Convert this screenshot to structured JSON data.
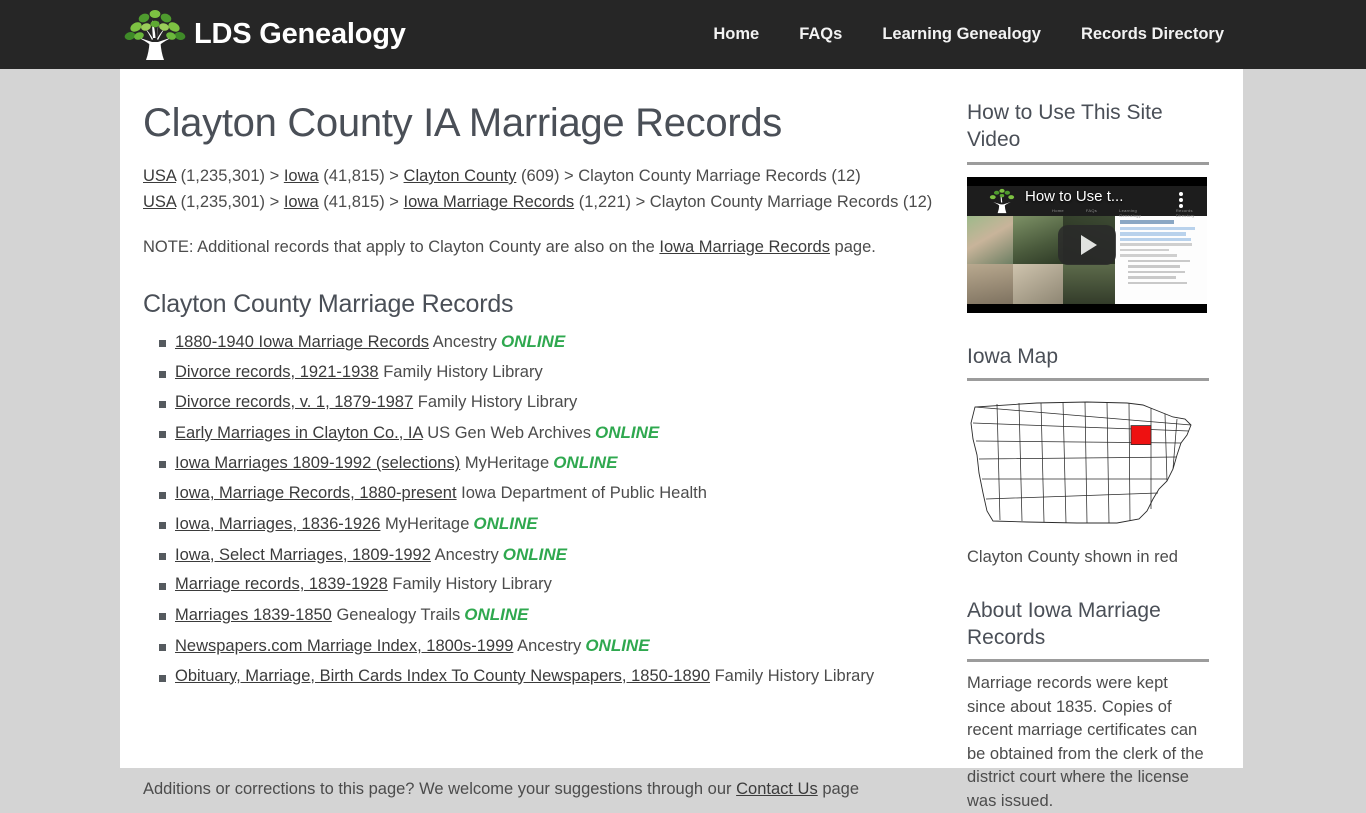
{
  "header": {
    "brand_name": "LDS Genealogy",
    "logo_icon": "family-tree-logo-icon",
    "nav": [
      {
        "label": "Home"
      },
      {
        "label": "FAQs"
      },
      {
        "label": "Learning Genealogy"
      },
      {
        "label": "Records Directory"
      }
    ]
  },
  "main": {
    "page_title": "Clayton County IA Marriage Records",
    "breadcrumb_rows": [
      {
        "parts": [
          {
            "text": "USA",
            "link": true
          },
          {
            "text": " (1,235,301) > ",
            "link": false
          },
          {
            "text": "Iowa",
            "link": true
          },
          {
            "text": " (41,815) > ",
            "link": false
          },
          {
            "text": "Clayton County",
            "link": true
          },
          {
            "text": " (609) > Clayton County Marriage Records (12)",
            "link": false
          }
        ]
      },
      {
        "parts": [
          {
            "text": "USA",
            "link": true
          },
          {
            "text": " (1,235,301) > ",
            "link": false
          },
          {
            "text": "Iowa",
            "link": true
          },
          {
            "text": " (41,815) > ",
            "link": false
          },
          {
            "text": "Iowa Marriage Records",
            "link": true
          },
          {
            "text": " (1,221) > Clayton County Marriage Records (12)",
            "link": false
          }
        ]
      }
    ],
    "note_prefix": "NOTE: Additional records that apply to Clayton County are also on the ",
    "note_link": "Iowa Marriage Records",
    "note_suffix": " page.",
    "section_heading": "Clayton County Marriage Records",
    "records": [
      {
        "title": "1880-1940 Iowa Marriage Records",
        "source": "Ancestry",
        "online": "ONLINE"
      },
      {
        "title": "Divorce records, 1921-1938",
        "source": "Family History Library",
        "online": ""
      },
      {
        "title": "Divorce records, v. 1, 1879-1987",
        "source": "Family History Library",
        "online": ""
      },
      {
        "title": "Early Marriages in Clayton Co., IA",
        "source": "US Gen Web Archives",
        "online": "ONLINE"
      },
      {
        "title": "Iowa Marriages 1809-1992 (selections)",
        "source": "MyHeritage",
        "online": "ONLINE"
      },
      {
        "title": "Iowa, Marriage Records, 1880-present",
        "source": "Iowa Department of Public Health",
        "online": ""
      },
      {
        "title": "Iowa, Marriages, 1836-1926",
        "source": "MyHeritage",
        "online": "ONLINE"
      },
      {
        "title": "Iowa, Select Marriages, 1809-1992",
        "source": "Ancestry",
        "online": "ONLINE"
      },
      {
        "title": "Marriage records, 1839-1928",
        "source": "Family History Library",
        "online": ""
      },
      {
        "title": "Marriages 1839-1850",
        "source": "Genealogy Trails",
        "online": "ONLINE"
      },
      {
        "title": "Newspapers.com Marriage Index, 1800s-1999",
        "source": "Ancestry",
        "online": "ONLINE"
      },
      {
        "title": "Obituary, Marriage, Birth Cards Index To County Newspapers, 1850-1890",
        "source": "Family History Library",
        "online": ""
      }
    ],
    "footer_prefix": "Additions or corrections to this page? We welcome your suggestions through our ",
    "footer_link": "Contact Us",
    "footer_suffix": " page"
  },
  "sidebar": {
    "video_widget": {
      "title": "How to Use This Site Video",
      "video_title": "How to Use t...",
      "play_icon": "play-button-icon",
      "menu_icon": "kebab-menu-icon",
      "nav_labels": [
        "Home",
        "FAQs",
        "Learning Genealogy",
        "Records Directory"
      ]
    },
    "map_widget": {
      "title": "Iowa Map",
      "caption": "Clayton County shown in red",
      "highlight_color": "#ee1111"
    },
    "about_widget": {
      "title": "About Iowa Marriage Records",
      "body": "Marriage records were kept since about 1835. Copies of recent marriage certificates can be obtained from the clerk of the district court where the license was issued."
    }
  }
}
